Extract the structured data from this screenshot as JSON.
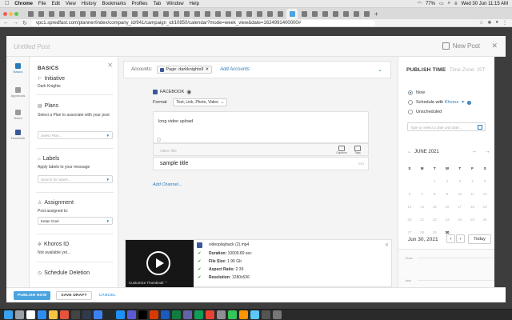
{
  "menubar": {
    "apple": "",
    "items": [
      "Chrome",
      "File",
      "Edit",
      "View",
      "History",
      "Bookmarks",
      "Profiles",
      "Tab",
      "Window",
      "Help"
    ],
    "battery": "77%",
    "clock": "Wed 30 Jun  11:15 AM"
  },
  "browser": {
    "url": "vpc1.spredfast.com/planner/index/company_id/941/campaign_id/10850/calendar?mode=week_view&date=1624991400000#"
  },
  "header": {
    "title": "Untitled Post",
    "new_post_label": "New Post",
    "close": "✕"
  },
  "rail": [
    {
      "label": "Basics",
      "active": true
    },
    {
      "label": "Approvals",
      "active": false
    },
    {
      "label": "Notes",
      "active": false
    },
    {
      "label": "Facebook",
      "active": false
    }
  ],
  "basics": {
    "heading": "BASICS",
    "initiative_title": "Initiative",
    "initiative_value": "Dark Knights",
    "plans_title": "Plans",
    "plans_help": "Select a Plan to associate with your post",
    "plans_placeholder": "Select Plan...",
    "labels_title": "Labels",
    "labels_help": "Apply labels to your message",
    "labels_placeholder": "Search for labels...",
    "assignment_title": "Assignment",
    "assignment_help": "Post assigned to:",
    "assignment_value": "Ketan Goel",
    "khoros_title": "Khoros ID",
    "khoros_value": "Not available yet...",
    "schedule_deletion_title": "Schedule Deletion"
  },
  "accounts": {
    "label": "Accounts:",
    "chip": "Page: darkknights9",
    "add_link": "Add Accounts"
  },
  "composer": {
    "network": "FACEBOOK",
    "format_label": "Format",
    "format_value": "Text, Link, Photo, Video",
    "message": "long video upload",
    "video_title_placeholder": "Video Title",
    "option_captions": "Captions",
    "option_tags": "Tags",
    "video_title_value": "sample title",
    "char_count": "243",
    "add_channel": "Add Channel..."
  },
  "video": {
    "customize_thumbnail": "Customize Thumbnail",
    "filename": "videoplayback (2).mp4",
    "duration_label": "Duration:",
    "duration_value": "10009.89 sec",
    "filesize_label": "File Size:",
    "filesize_value": "1.96 Gb",
    "aspect_label": "Aspect Ratio:",
    "aspect_value": "2.39",
    "resolution_label": "Resolution:",
    "resolution_value": "1280x536"
  },
  "publish": {
    "heading": "PUBLISH TIME",
    "timezone": "Time Zone: IST",
    "now": "Now",
    "schedule_with": "Schedule with",
    "schedule_brand": "Khoros",
    "unscheduled": "Unscheduled",
    "date_placeholder": "Type or select a date and date...",
    "month": "JUNE 2021",
    "dow": [
      "S",
      "M",
      "T",
      "W",
      "T",
      "F",
      "S"
    ],
    "weeks": [
      [
        "",
        "",
        "1",
        "2",
        "3",
        "4",
        "5"
      ],
      [
        "6",
        "7",
        "8",
        "9",
        "10",
        "11",
        "12"
      ],
      [
        "13",
        "14",
        "15",
        "16",
        "17",
        "18",
        "19"
      ],
      [
        "20",
        "21",
        "22",
        "23",
        "24",
        "25",
        "26"
      ],
      [
        "27",
        "28",
        "29",
        "30",
        "",
        "",
        ""
      ]
    ],
    "today_day": "30",
    "selected_date": "Jun 30, 2021",
    "today_button": "Today",
    "time_12am": "12am",
    "time_1am": "1am"
  },
  "footer": {
    "publish_now": "PUBLISH NOW",
    "save_draft": "SAVE DRAFT",
    "cancel": "CANCEL"
  }
}
